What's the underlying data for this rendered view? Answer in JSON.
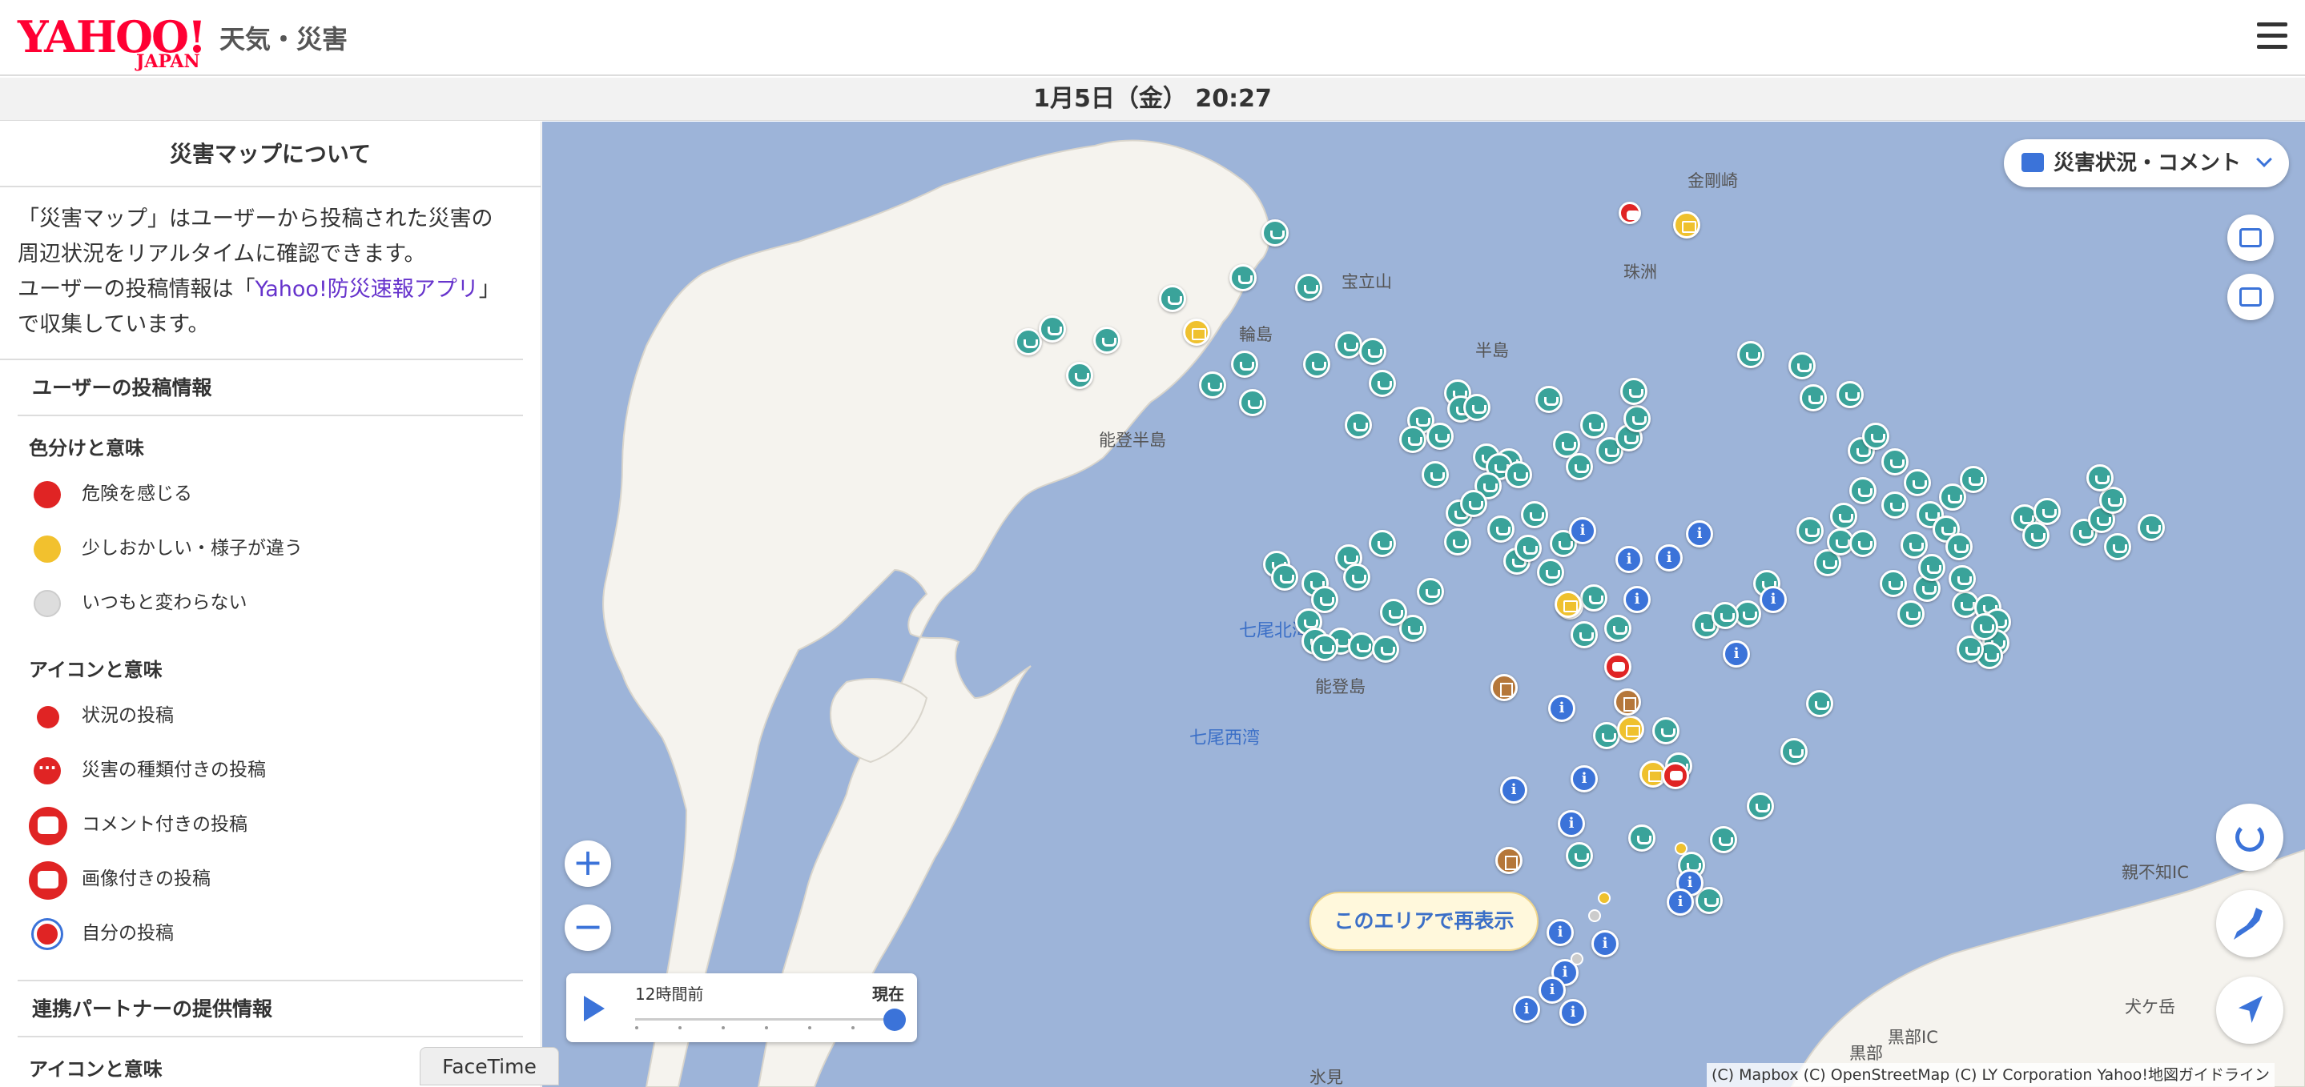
{
  "header": {
    "logo_text": "YAHOO!",
    "logo_sub": "JAPAN",
    "service_name": "天気・災害"
  },
  "datebar": {
    "datetime": "1月5日（金） 20:27"
  },
  "sidebar": {
    "title": "災害マップについて",
    "intro_part1": "「災害マップ」はユーザーから投稿された災害の周辺状況をリアルタイムに確認できます。",
    "intro_part2_prefix": "ユーザーの投稿情報は「",
    "intro_link": "Yahoo!防災速報アプリ",
    "intro_part2_suffix": "」で収集しています。",
    "user_posts_heading": "ユーザーの投稿情報",
    "color_heading": "色分けと意味",
    "colors": [
      {
        "label": "危険を感じる",
        "color": "#e02424"
      },
      {
        "label": "少しおかしい・様子が違う",
        "color": "#f2c12e"
      },
      {
        "label": "いつもと変わらない",
        "color": "#dddddd"
      }
    ],
    "icon_heading": "アイコンと意味",
    "icons": [
      {
        "label": "状況の投稿",
        "icon": "status-post-icon"
      },
      {
        "label": "災害の種類付きの投稿",
        "icon": "disaster-type-post-icon"
      },
      {
        "label": "コメント付きの投稿",
        "icon": "comment-post-icon"
      },
      {
        "label": "画像付きの投稿",
        "icon": "image-post-icon"
      },
      {
        "label": "自分の投稿",
        "icon": "own-post-icon"
      }
    ],
    "partner_heading": "連携パートナーの提供情報",
    "partner_icon_heading": "アイコンと意味"
  },
  "map": {
    "layer_dropdown": "災害状況・コメント",
    "places": {
      "kongosaki": "金剛崎",
      "hodatsu": "宝立山",
      "suzu": "珠洲",
      "wajima": "輪島",
      "hanto": "半島",
      "noto_hanto": "能登半島",
      "nanao_hokuwan": "七尾北湾",
      "notojima": "能登島",
      "nanao_seiwan": "七尾西湾",
      "himi": "氷見",
      "oyashirazu": "親不知IC",
      "inudake": "犬ケ岳",
      "kurobe": "黒部",
      "kurobe_ic": "黒部IC"
    },
    "reshow_button": "このエリアで再表示",
    "timeline": {
      "start_label": "12時間前",
      "end_label": "現在"
    },
    "attribution": "(C) Mapbox (C) OpenStreetMap (C) LY Corporation Yahoo!地図ガイドライン",
    "zoom_in": "+",
    "zoom_out": "−"
  },
  "dock": {
    "facetime": "FaceTime"
  }
}
